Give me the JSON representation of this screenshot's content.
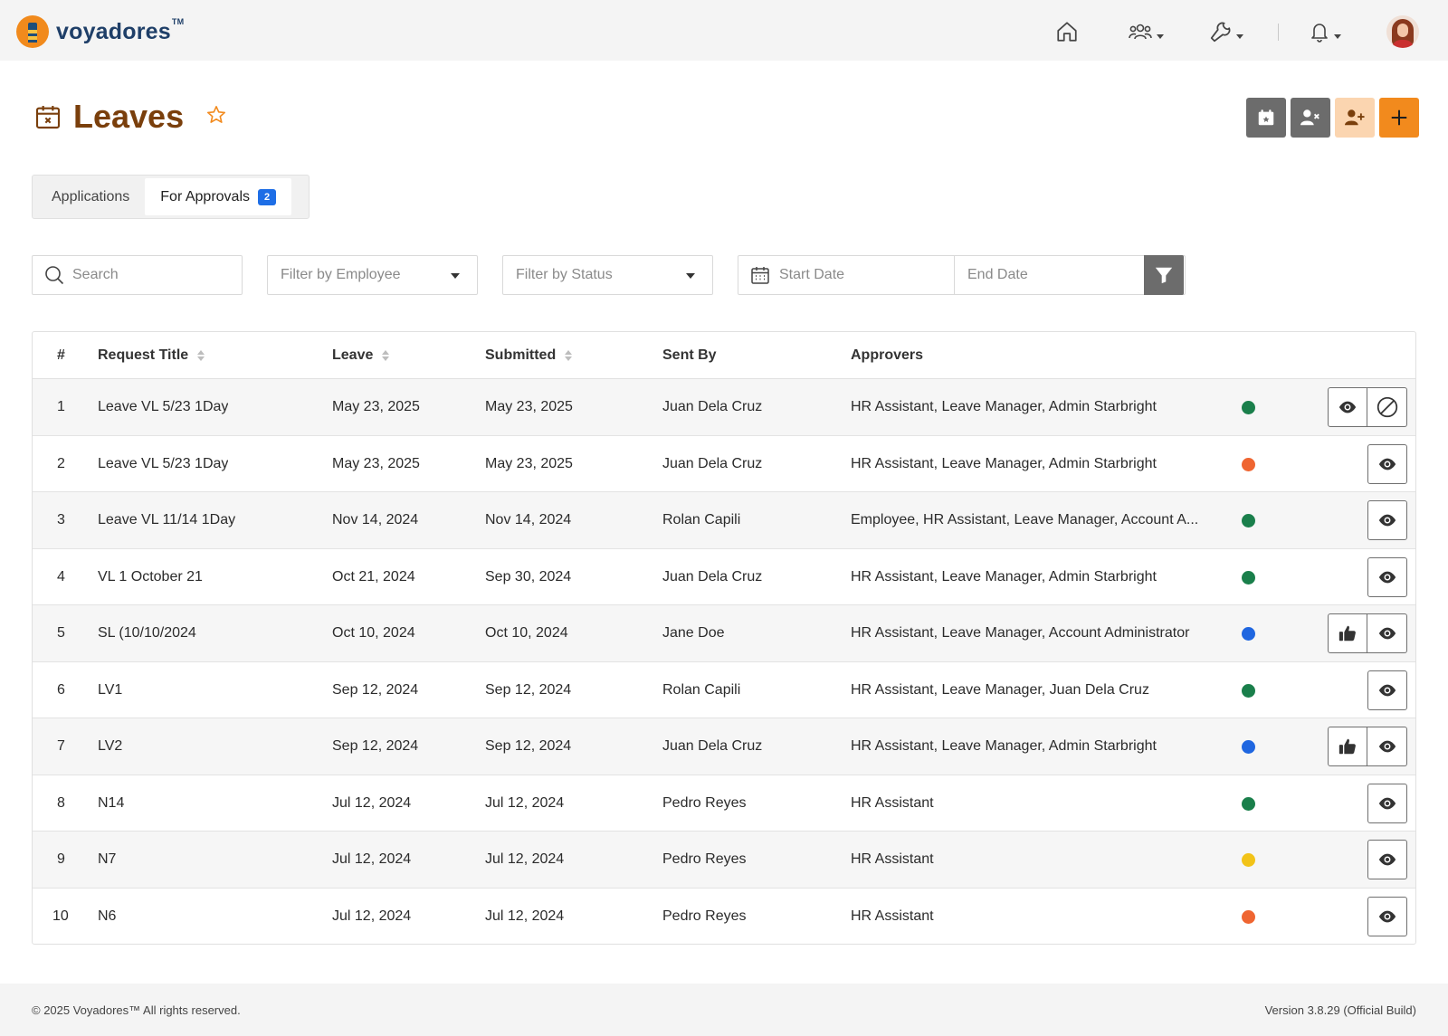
{
  "brand": {
    "name": "voyadores",
    "tm": "TM"
  },
  "nav": {
    "icons": [
      "home-icon",
      "users-icon",
      "wrench-icon",
      "bell-icon"
    ]
  },
  "page": {
    "title": "Leaves"
  },
  "header_actions": [
    {
      "icon": "calendar-star-icon",
      "color": "#6c6c6c"
    },
    {
      "icon": "user-remove-icon",
      "color": "#6c6c6c"
    },
    {
      "icon": "user-add-icon",
      "color": "#fbd5b0"
    },
    {
      "icon": "plus-icon",
      "color": "#f28a1d"
    }
  ],
  "tabs": [
    {
      "label": "Applications",
      "active": false
    },
    {
      "label": "For Approvals",
      "active": true,
      "badge": "2"
    }
  ],
  "filters": {
    "search_placeholder": "Search",
    "employee_placeholder": "Filter by Employee",
    "status_placeholder": "Filter by Status",
    "start_date_placeholder": "Start Date",
    "end_date_placeholder": "End Date"
  },
  "table": {
    "columns": {
      "num": "#",
      "title": "Request Title",
      "leave": "Leave",
      "submitted": "Submitted",
      "sent_by": "Sent By",
      "approvers": "Approvers"
    },
    "rows": [
      {
        "num": "1",
        "title": "Leave VL 5/23 1Day",
        "leave": "May 23, 2025",
        "submitted": "May 23, 2025",
        "sent_by": "Juan Dela Cruz",
        "approvers": "HR Assistant, Leave Manager, Admin Starbright",
        "status_color": "#1a7f4b",
        "actions": [
          "view",
          "cancel"
        ]
      },
      {
        "num": "2",
        "title": "Leave VL 5/23 1Day",
        "leave": "May 23, 2025",
        "submitted": "May 23, 2025",
        "sent_by": "Juan Dela Cruz",
        "approvers": "HR Assistant, Leave Manager, Admin Starbright",
        "status_color": "#ef6531",
        "actions": [
          "view"
        ]
      },
      {
        "num": "3",
        "title": "Leave VL 11/14 1Day",
        "leave": "Nov 14, 2024",
        "submitted": "Nov 14, 2024",
        "sent_by": "Rolan Capili",
        "approvers": "Employee, HR Assistant, Leave Manager, Account A...",
        "status_color": "#1a7f4b",
        "actions": [
          "view"
        ]
      },
      {
        "num": "4",
        "title": "VL 1 October 21",
        "leave": "Oct 21, 2024",
        "submitted": "Sep 30, 2024",
        "sent_by": "Juan Dela Cruz",
        "approvers": "HR Assistant, Leave Manager, Admin Starbright",
        "status_color": "#1a7f4b",
        "actions": [
          "view"
        ]
      },
      {
        "num": "5",
        "title": "SL (10/10/2024",
        "leave": "Oct 10, 2024",
        "submitted": "Oct 10, 2024",
        "sent_by": "Jane Doe",
        "approvers": "HR Assistant, Leave Manager, Account Administrator",
        "status_color": "#1f66e0",
        "actions": [
          "approve",
          "view"
        ]
      },
      {
        "num": "6",
        "title": "LV1",
        "leave": "Sep 12, 2024",
        "submitted": "Sep 12, 2024",
        "sent_by": "Rolan Capili",
        "approvers": "HR Assistant, Leave Manager, Juan Dela Cruz",
        "status_color": "#1a7f4b",
        "actions": [
          "view"
        ]
      },
      {
        "num": "7",
        "title": "LV2",
        "leave": "Sep 12, 2024",
        "submitted": "Sep 12, 2024",
        "sent_by": "Juan Dela Cruz",
        "approvers": "HR Assistant, Leave Manager, Admin Starbright",
        "status_color": "#1f66e0",
        "actions": [
          "approve",
          "view"
        ]
      },
      {
        "num": "8",
        "title": "N14",
        "leave": "Jul 12, 2024",
        "submitted": "Jul 12, 2024",
        "sent_by": "Pedro Reyes",
        "approvers": "HR Assistant",
        "status_color": "#1a7f4b",
        "actions": [
          "view"
        ]
      },
      {
        "num": "9",
        "title": "N7",
        "leave": "Jul 12, 2024",
        "submitted": "Jul 12, 2024",
        "sent_by": "Pedro Reyes",
        "approvers": "HR Assistant",
        "status_color": "#f2c318",
        "actions": [
          "view"
        ]
      },
      {
        "num": "10",
        "title": "N6",
        "leave": "Jul 12, 2024",
        "submitted": "Jul 12, 2024",
        "sent_by": "Pedro Reyes",
        "approvers": "HR Assistant",
        "status_color": "#ef6531",
        "actions": [
          "view"
        ]
      }
    ]
  },
  "footer": {
    "copyright": "© 2025 Voyadores™ All rights reserved.",
    "version": "Version 3.8.29 (Official Build)"
  }
}
